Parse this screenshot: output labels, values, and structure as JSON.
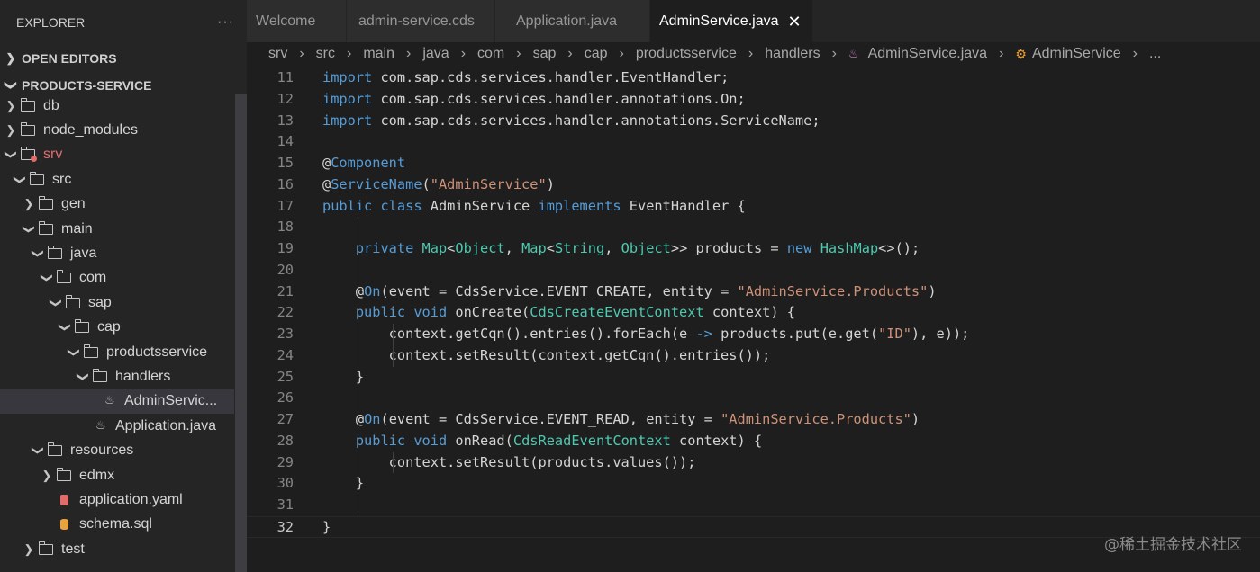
{
  "explorer": {
    "title": "EXPLORER",
    "more": "···",
    "open_editors": "OPEN EDITORS",
    "project": "PRODUCTS-SERVICE",
    "tree": [
      {
        "label": "db",
        "depth": 0,
        "kind": "folder",
        "open": false
      },
      {
        "label": "node_modules",
        "depth": 0,
        "kind": "folder",
        "open": false
      },
      {
        "label": "srv",
        "depth": 0,
        "kind": "folder",
        "open": true,
        "modified": true
      },
      {
        "label": "src",
        "depth": 1,
        "kind": "folder",
        "open": true
      },
      {
        "label": "gen",
        "depth": 2,
        "kind": "folder",
        "open": false
      },
      {
        "label": "main",
        "depth": 2,
        "kind": "folder",
        "open": true
      },
      {
        "label": "java",
        "depth": 3,
        "kind": "folder",
        "open": true
      },
      {
        "label": "com",
        "depth": 4,
        "kind": "folder",
        "open": true
      },
      {
        "label": "sap",
        "depth": 5,
        "kind": "folder",
        "open": true
      },
      {
        "label": "cap",
        "depth": 6,
        "kind": "folder",
        "open": true
      },
      {
        "label": "productsservice",
        "depth": 7,
        "kind": "folder",
        "open": true
      },
      {
        "label": "handlers",
        "depth": 8,
        "kind": "folder",
        "open": true
      },
      {
        "label": "AdminServic...",
        "depth": 9,
        "kind": "java",
        "selected": true
      },
      {
        "label": "Application.java",
        "depth": 8,
        "kind": "java"
      },
      {
        "label": "resources",
        "depth": 3,
        "kind": "folder",
        "open": true
      },
      {
        "label": "edmx",
        "depth": 4,
        "kind": "folder",
        "open": false
      },
      {
        "label": "application.yaml",
        "depth": 4,
        "kind": "yaml"
      },
      {
        "label": "schema.sql",
        "depth": 4,
        "kind": "sql"
      },
      {
        "label": "test",
        "depth": 2,
        "kind": "folder",
        "open": false
      }
    ]
  },
  "tabs": [
    {
      "label": "Welcome",
      "active": false
    },
    {
      "label": "admin-service.cds",
      "active": false
    },
    {
      "label": "Application.java",
      "active": false
    },
    {
      "label": "AdminService.java",
      "active": true
    }
  ],
  "breadcrumb": [
    "srv",
    "src",
    "main",
    "java",
    "com",
    "sap",
    "cap",
    "productsservice",
    "handlers",
    "AdminService.java",
    "AdminService",
    "..."
  ],
  "editor": {
    "current_line": 32,
    "lines": [
      {
        "n": "11",
        "indent": 0,
        "tokens": [
          [
            "kw",
            "import"
          ],
          [
            "txt",
            " com.sap.cds.services.handler.EventHandler;"
          ]
        ]
      },
      {
        "n": "12",
        "indent": 0,
        "tokens": [
          [
            "kw",
            "import"
          ],
          [
            "txt",
            " com.sap.cds.services.handler.annotations.On;"
          ]
        ]
      },
      {
        "n": "13",
        "indent": 0,
        "tokens": [
          [
            "kw",
            "import"
          ],
          [
            "txt",
            " com.sap.cds.services.handler.annotations.ServiceName;"
          ]
        ]
      },
      {
        "n": "14",
        "indent": 0,
        "tokens": []
      },
      {
        "n": "15",
        "indent": 0,
        "tokens": [
          [
            "txt",
            "@"
          ],
          [
            "kw",
            "Component"
          ]
        ]
      },
      {
        "n": "16",
        "indent": 0,
        "tokens": [
          [
            "txt",
            "@"
          ],
          [
            "kw",
            "ServiceName"
          ],
          [
            "txt",
            "("
          ],
          [
            "str",
            "\"AdminService\""
          ],
          [
            "txt",
            ")"
          ]
        ]
      },
      {
        "n": "17",
        "indent": 0,
        "tokens": [
          [
            "kw",
            "public"
          ],
          [
            "txt",
            " "
          ],
          [
            "kw",
            "class"
          ],
          [
            "txt",
            " AdminService "
          ],
          [
            "kw",
            "implements"
          ],
          [
            "txt",
            " EventHandler {"
          ]
        ]
      },
      {
        "n": "18",
        "indent": 1,
        "tokens": []
      },
      {
        "n": "19",
        "indent": 1,
        "tokens": [
          [
            "txt",
            "    "
          ],
          [
            "kw",
            "private"
          ],
          [
            "txt",
            " "
          ],
          [
            "ty",
            "Map"
          ],
          [
            "txt",
            "<"
          ],
          [
            "ty",
            "Object"
          ],
          [
            "txt",
            ", "
          ],
          [
            "ty",
            "Map"
          ],
          [
            "txt",
            "<"
          ],
          [
            "ty",
            "String"
          ],
          [
            "txt",
            ", "
          ],
          [
            "ty",
            "Object"
          ],
          [
            "txt",
            ">> products = "
          ],
          [
            "kw",
            "new"
          ],
          [
            "txt",
            " "
          ],
          [
            "ty",
            "HashMap"
          ],
          [
            "txt",
            "<>();"
          ]
        ]
      },
      {
        "n": "20",
        "indent": 1,
        "tokens": []
      },
      {
        "n": "21",
        "indent": 1,
        "tokens": [
          [
            "txt",
            "    @"
          ],
          [
            "kw",
            "On"
          ],
          [
            "txt",
            "(event = CdsService.EVENT_CREATE, entity = "
          ],
          [
            "str",
            "\"AdminService.Products\""
          ],
          [
            "txt",
            ")"
          ]
        ]
      },
      {
        "n": "22",
        "indent": 1,
        "tokens": [
          [
            "txt",
            "    "
          ],
          [
            "kw",
            "public"
          ],
          [
            "txt",
            " "
          ],
          [
            "kw",
            "void"
          ],
          [
            "txt",
            " onCreate("
          ],
          [
            "ty",
            "CdsCreateEventContext"
          ],
          [
            "txt",
            " context) {"
          ]
        ]
      },
      {
        "n": "23",
        "indent": 2,
        "tokens": [
          [
            "txt",
            "        context.getCqn().entries().forEach(e "
          ],
          [
            "kw",
            "->"
          ],
          [
            "txt",
            " products.put(e.get("
          ],
          [
            "str",
            "\"ID\""
          ],
          [
            "txt",
            "), e));"
          ]
        ]
      },
      {
        "n": "24",
        "indent": 2,
        "tokens": [
          [
            "txt",
            "        context.setResult(context.getCqn().entries());"
          ]
        ]
      },
      {
        "n": "25",
        "indent": 1,
        "tokens": [
          [
            "txt",
            "    }"
          ]
        ]
      },
      {
        "n": "26",
        "indent": 1,
        "tokens": []
      },
      {
        "n": "27",
        "indent": 1,
        "tokens": [
          [
            "txt",
            "    @"
          ],
          [
            "kw",
            "On"
          ],
          [
            "txt",
            "(event = CdsService.EVENT_READ, entity = "
          ],
          [
            "str",
            "\"AdminService.Products\""
          ],
          [
            "txt",
            ")"
          ]
        ]
      },
      {
        "n": "28",
        "indent": 1,
        "tokens": [
          [
            "txt",
            "    "
          ],
          [
            "kw",
            "public"
          ],
          [
            "txt",
            " "
          ],
          [
            "kw",
            "void"
          ],
          [
            "txt",
            " onRead("
          ],
          [
            "ty",
            "CdsReadEventContext"
          ],
          [
            "txt",
            " context) {"
          ]
        ]
      },
      {
        "n": "29",
        "indent": 2,
        "tokens": [
          [
            "txt",
            "        context.setResult(products.values());"
          ]
        ]
      },
      {
        "n": "30",
        "indent": 1,
        "tokens": [
          [
            "txt",
            "    }"
          ]
        ]
      },
      {
        "n": "31",
        "indent": 1,
        "tokens": []
      },
      {
        "n": "32",
        "indent": 0,
        "tokens": [
          [
            "txt",
            "}"
          ]
        ]
      }
    ]
  },
  "watermark": "@稀土掘金技术社区"
}
